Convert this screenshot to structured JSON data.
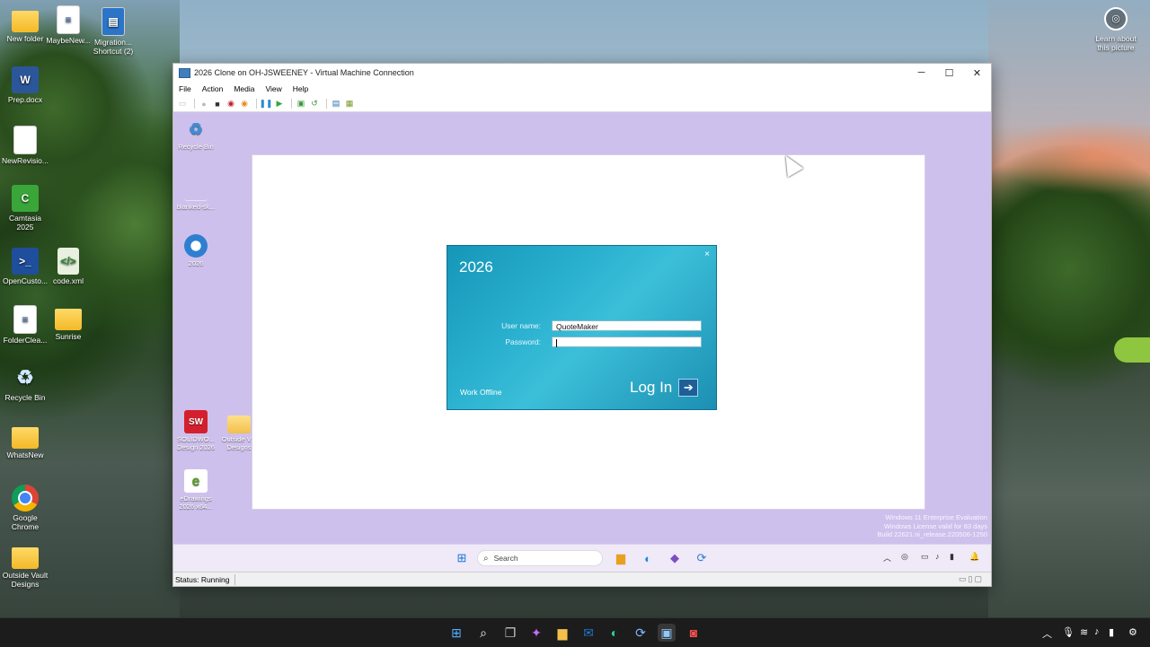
{
  "host_desktop": {
    "icons": [
      {
        "label": "New folder",
        "icon": "folder-icon"
      },
      {
        "label": "MaybeNew...",
        "icon": "document-icon"
      },
      {
        "label": "Migration... Shortcut (2)",
        "icon": "shortcut-icon"
      },
      {
        "label": "Prep.docx",
        "icon": "word-icon"
      },
      {
        "label": "NewRevisio...",
        "icon": "document-icon"
      },
      {
        "label": "Camtasia 2025",
        "icon": "camtasia-icon"
      },
      {
        "label": "OpenCusto...",
        "icon": "powershell-icon"
      },
      {
        "label": "code.xml",
        "icon": "xml-icon"
      },
      {
        "label": "FolderClea...",
        "icon": "document-icon"
      },
      {
        "label": "Sunrise",
        "icon": "folder-icon"
      },
      {
        "label": "Recycle Bin",
        "icon": "recycle-bin-icon"
      },
      {
        "label": "WhatsNew",
        "icon": "folder-icon"
      },
      {
        "label": "Google Chrome",
        "icon": "chrome-icon"
      },
      {
        "label": "Outside Vault Designs",
        "icon": "folder-icon"
      }
    ],
    "learn_label": "Learn about this picture"
  },
  "vm_window": {
    "title": "2026 Clone on OH-JSWEENEY - Virtual Machine Connection",
    "controls": {
      "minimize": "─",
      "maximize": "☐",
      "close": "✕"
    },
    "menu": [
      "File",
      "Action",
      "Media",
      "View",
      "Help"
    ],
    "status": "Status: Running"
  },
  "guest_desktop": {
    "icons": [
      {
        "label": "Recycle Bin",
        "icon": "recycle-bin-icon"
      },
      {
        "label": "blanked-sk...",
        "icon": "blank-file-icon"
      },
      {
        "label": "2026",
        "icon": "sync-icon"
      },
      {
        "label": "SOLIDWO... Design 2026",
        "icon": "solidworks-icon",
        "badge": "SW"
      },
      {
        "label": "Outside V... Designs",
        "icon": "folder-icon"
      },
      {
        "label": "eDrawings 2026 x64...",
        "icon": "edrawings-icon"
      }
    ],
    "watermark": [
      "Windows 11 Enterprise Evaluation",
      "Windows License valid for 83 days",
      "Build 22621.ni_release.220506-1250"
    ],
    "search_placeholder": "Search"
  },
  "login_dialog": {
    "title": "2026",
    "close": "×",
    "username_label": "User name:",
    "username_value": "QuoteMaker",
    "password_label": "Password:",
    "password_value": "",
    "work_offline": "Work Offline",
    "login_button": "Log In",
    "login_arrow": "➔",
    "accent_color": "#1ea3c6"
  }
}
